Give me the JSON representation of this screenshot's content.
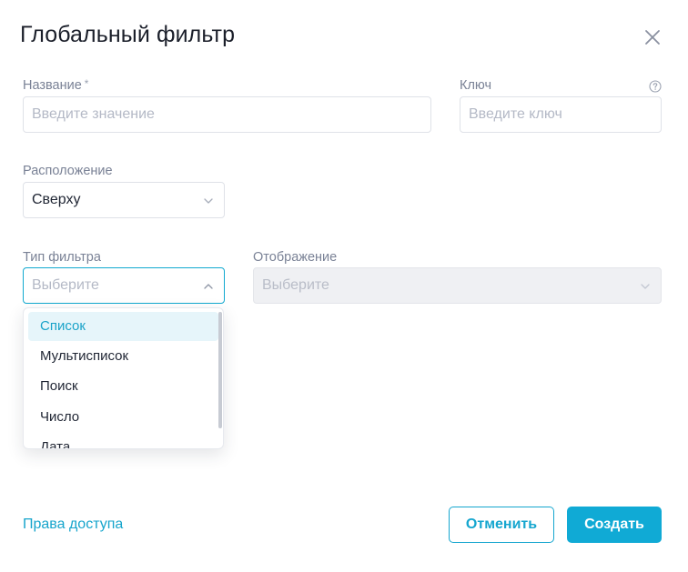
{
  "dialog": {
    "title": "Глобальный фильтр"
  },
  "fields": {
    "name": {
      "label": "Название",
      "required_mark": "*",
      "placeholder": "Введите значение"
    },
    "key": {
      "label": "Ключ",
      "placeholder": "Введите ключ",
      "help_icon": "question-circle-icon"
    },
    "position": {
      "label": "Расположение",
      "value": "Сверху"
    },
    "filter_type": {
      "label": "Тип фильтра",
      "placeholder": "Выберите",
      "state": "open"
    },
    "display": {
      "label": "Отображение",
      "placeholder": "Выберите",
      "state": "disabled"
    }
  },
  "dropdown": {
    "items": [
      "Список",
      "Мультисписок",
      "Поиск",
      "Число",
      "Дата"
    ],
    "highlighted_index": 0
  },
  "footer": {
    "access_link": "Права доступа",
    "cancel_label": "Отменить",
    "create_label": "Создать"
  },
  "colors": {
    "accent": "#10aad5",
    "highlight_bg": "#e6f5fa",
    "label": "#7a8296",
    "placeholder": "#b4b9c6",
    "disabled_bg": "#eff0f3"
  }
}
